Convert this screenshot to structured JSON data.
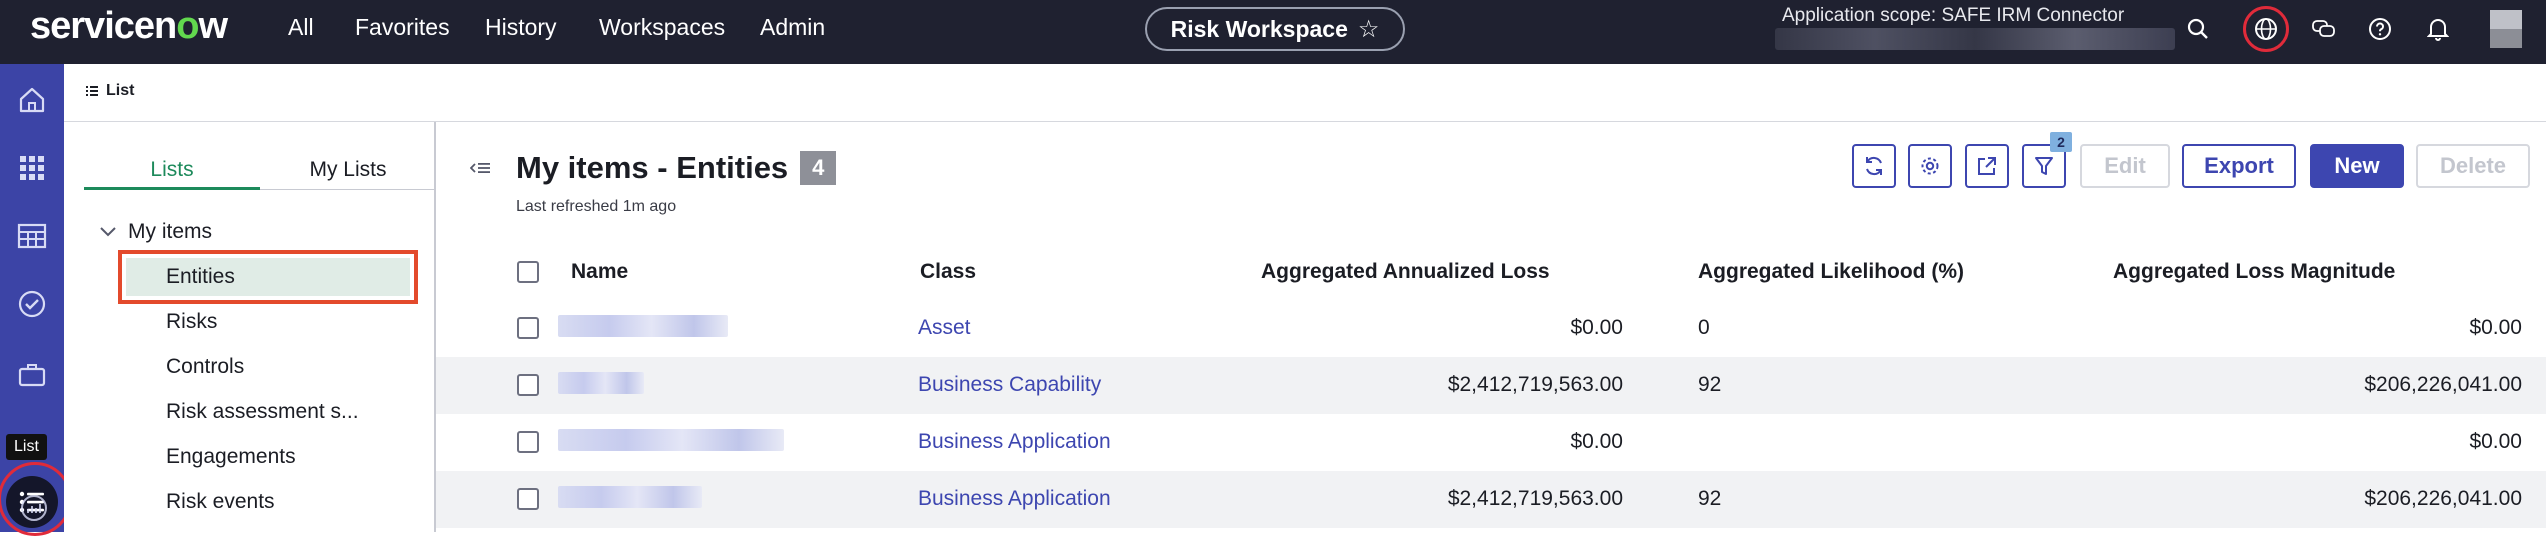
{
  "header": {
    "logo_pre": "servicen",
    "logo_o": "o",
    "logo_post": "w",
    "nav": [
      "All",
      "Favorites",
      "History",
      "Workspaces",
      "Admin"
    ],
    "workspace_title": "Risk Workspace",
    "workspace_star": "☆",
    "scope_text": "Application scope: SAFE IRM Connector",
    "icons": [
      "search-icon",
      "globe-icon",
      "chat-icon",
      "help-icon",
      "bell-icon",
      "avatar"
    ]
  },
  "rail": {
    "icons": [
      "home-icon",
      "apps-grid-icon",
      "table-icon",
      "checkmark-circle-icon",
      "list-icon",
      "analytics-icon"
    ],
    "tooltip": "List"
  },
  "breadcrumb": {
    "label": "List"
  },
  "lists_panel": {
    "tabs": [
      "Lists",
      "My Lists"
    ],
    "active_tab": "Lists",
    "group": "My items",
    "items": [
      "Entities",
      "Risks",
      "Controls",
      "Risk assessment s...",
      "Engagements",
      "Risk events"
    ],
    "selected": "Entities"
  },
  "main": {
    "title": "My items - Entities",
    "count": "4",
    "last_refreshed": "Last refreshed 1m ago",
    "filter_count": "2",
    "buttons": {
      "edit": "Edit",
      "export": "Export",
      "new": "New",
      "delete": "Delete"
    },
    "columns": [
      "Name",
      "Class",
      "Aggregated Annualized Loss",
      "Aggregated Likelihood (%)",
      "Aggregated Loss Magnitude"
    ],
    "rows": [
      {
        "class": "Asset",
        "annualized_loss": "$0.00",
        "likelihood": "0",
        "loss_magnitude": "$0.00"
      },
      {
        "class": "Business Capability",
        "annualized_loss": "$2,412,719,563.00",
        "likelihood": "92",
        "loss_magnitude": "$206,226,041.00"
      },
      {
        "class": "Business Application",
        "annualized_loss": "$0.00",
        "likelihood": "",
        "loss_magnitude": "$0.00"
      },
      {
        "class": "Business Application",
        "annualized_loss": "$2,412,719,563.00",
        "likelihood": "92",
        "loss_magnitude": "$206,226,041.00"
      }
    ]
  },
  "colors": {
    "header_bg": "#1f2130",
    "rail_bg": "#3c44a6",
    "accent": "#3d46b0",
    "tab_active": "#1d8a5b",
    "highlight": "#e34a2c"
  }
}
